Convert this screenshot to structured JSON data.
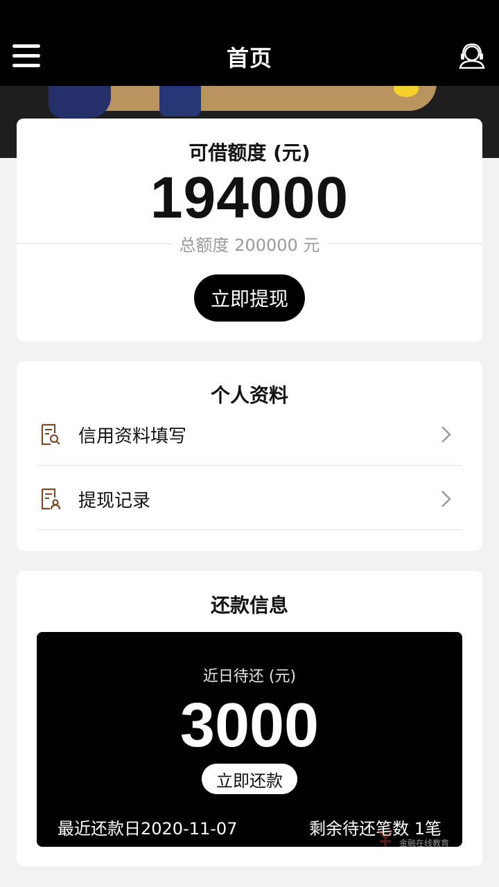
{
  "navbar": {
    "title": "首页",
    "menu_icon": "hamburger-menu-icon",
    "service_icon": "customer-service-icon"
  },
  "credit": {
    "label": "可借额度 (元)",
    "amount": "194000",
    "total_text": "总额度 200000 元",
    "withdraw_button": "立即提现"
  },
  "profile": {
    "title": "个人资料",
    "items": [
      {
        "label": "信用资料填写",
        "icon": "document-search-icon"
      },
      {
        "label": "提现记录",
        "icon": "document-person-icon"
      }
    ]
  },
  "repayment": {
    "title": "还款信息",
    "due_label": "近日待还 (元)",
    "due_amount": "3000",
    "repay_button": "立即还款",
    "last_date_text": "最近还款日2020-11-07",
    "remaining_text": "剩余待还笔数 1笔"
  },
  "watermark": {
    "text": "金融在线教育"
  },
  "colors": {
    "primary": "#000000",
    "background": "#f2f2f2",
    "card": "#ffffff",
    "icon_brown": "#7a4a2a",
    "muted_text": "#9a9a9a"
  }
}
